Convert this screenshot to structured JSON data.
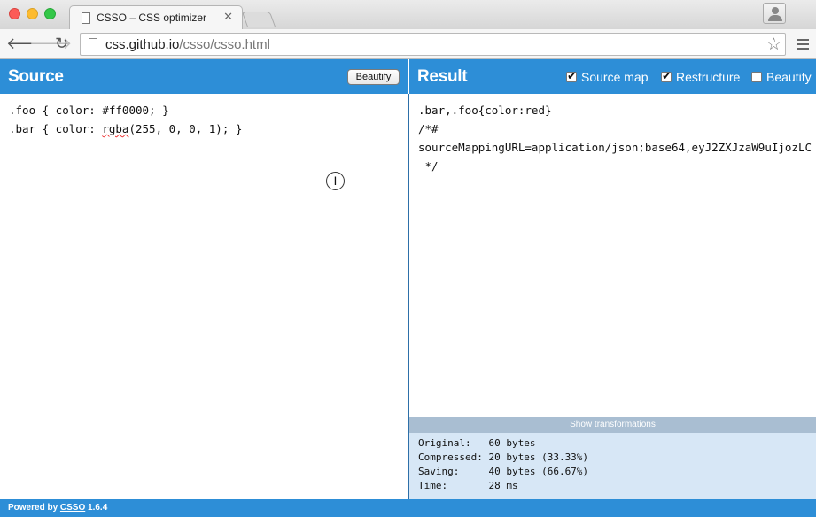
{
  "browser": {
    "tab_title": "CSSO – CSS optimizer",
    "tab_close": "✕",
    "url_domain": "css.github.io",
    "url_path": "/csso/csso.html"
  },
  "source": {
    "title": "Source",
    "beautify_label": "Beautify",
    "lines": [
      ".foo { color: #ff0000; }",
      ".bar { color: ",
      "rgba",
      "(255, 0, 0, 1); }"
    ]
  },
  "result": {
    "title": "Result",
    "options": [
      {
        "label": "Source map",
        "checked": true
      },
      {
        "label": "Restructure",
        "checked": true
      },
      {
        "label": "Beautify",
        "checked": false
      }
    ],
    "output_lines": [
      ".bar,.foo{color:red}",
      "/*#",
      "sourceMappingURL=application/json;base64,eyJ2ZXJzaW9uIjozLC",
      " */"
    ],
    "show_transformations": "Show transformations",
    "stats": [
      "Original:   60 bytes",
      "Compressed: 20 bytes (33.33%)",
      "Saving:     40 bytes (66.67%)",
      "Time:       28 ms"
    ]
  },
  "footer": {
    "prefix": "Powered by ",
    "link": "CSSO",
    "version": " 1.6.4"
  }
}
